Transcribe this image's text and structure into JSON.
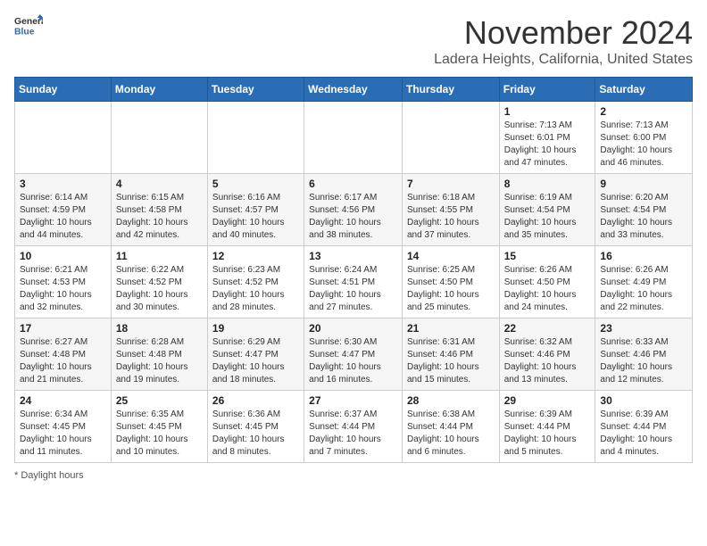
{
  "header": {
    "logo_line1": "General",
    "logo_line2": "Blue",
    "month_title": "November 2024",
    "location": "Ladera Heights, California, United States"
  },
  "weekdays": [
    "Sunday",
    "Monday",
    "Tuesday",
    "Wednesday",
    "Thursday",
    "Friday",
    "Saturday"
  ],
  "weeks": [
    [
      {
        "day": "",
        "info": ""
      },
      {
        "day": "",
        "info": ""
      },
      {
        "day": "",
        "info": ""
      },
      {
        "day": "",
        "info": ""
      },
      {
        "day": "",
        "info": ""
      },
      {
        "day": "1",
        "info": "Sunrise: 7:13 AM\nSunset: 6:01 PM\nDaylight: 10 hours and 47 minutes."
      },
      {
        "day": "2",
        "info": "Sunrise: 7:13 AM\nSunset: 6:00 PM\nDaylight: 10 hours and 46 minutes."
      }
    ],
    [
      {
        "day": "3",
        "info": "Sunrise: 6:14 AM\nSunset: 4:59 PM\nDaylight: 10 hours and 44 minutes."
      },
      {
        "day": "4",
        "info": "Sunrise: 6:15 AM\nSunset: 4:58 PM\nDaylight: 10 hours and 42 minutes."
      },
      {
        "day": "5",
        "info": "Sunrise: 6:16 AM\nSunset: 4:57 PM\nDaylight: 10 hours and 40 minutes."
      },
      {
        "day": "6",
        "info": "Sunrise: 6:17 AM\nSunset: 4:56 PM\nDaylight: 10 hours and 38 minutes."
      },
      {
        "day": "7",
        "info": "Sunrise: 6:18 AM\nSunset: 4:55 PM\nDaylight: 10 hours and 37 minutes."
      },
      {
        "day": "8",
        "info": "Sunrise: 6:19 AM\nSunset: 4:54 PM\nDaylight: 10 hours and 35 minutes."
      },
      {
        "day": "9",
        "info": "Sunrise: 6:20 AM\nSunset: 4:54 PM\nDaylight: 10 hours and 33 minutes."
      }
    ],
    [
      {
        "day": "10",
        "info": "Sunrise: 6:21 AM\nSunset: 4:53 PM\nDaylight: 10 hours and 32 minutes."
      },
      {
        "day": "11",
        "info": "Sunrise: 6:22 AM\nSunset: 4:52 PM\nDaylight: 10 hours and 30 minutes."
      },
      {
        "day": "12",
        "info": "Sunrise: 6:23 AM\nSunset: 4:52 PM\nDaylight: 10 hours and 28 minutes."
      },
      {
        "day": "13",
        "info": "Sunrise: 6:24 AM\nSunset: 4:51 PM\nDaylight: 10 hours and 27 minutes."
      },
      {
        "day": "14",
        "info": "Sunrise: 6:25 AM\nSunset: 4:50 PM\nDaylight: 10 hours and 25 minutes."
      },
      {
        "day": "15",
        "info": "Sunrise: 6:26 AM\nSunset: 4:50 PM\nDaylight: 10 hours and 24 minutes."
      },
      {
        "day": "16",
        "info": "Sunrise: 6:26 AM\nSunset: 4:49 PM\nDaylight: 10 hours and 22 minutes."
      }
    ],
    [
      {
        "day": "17",
        "info": "Sunrise: 6:27 AM\nSunset: 4:48 PM\nDaylight: 10 hours and 21 minutes."
      },
      {
        "day": "18",
        "info": "Sunrise: 6:28 AM\nSunset: 4:48 PM\nDaylight: 10 hours and 19 minutes."
      },
      {
        "day": "19",
        "info": "Sunrise: 6:29 AM\nSunset: 4:47 PM\nDaylight: 10 hours and 18 minutes."
      },
      {
        "day": "20",
        "info": "Sunrise: 6:30 AM\nSunset: 4:47 PM\nDaylight: 10 hours and 16 minutes."
      },
      {
        "day": "21",
        "info": "Sunrise: 6:31 AM\nSunset: 4:46 PM\nDaylight: 10 hours and 15 minutes."
      },
      {
        "day": "22",
        "info": "Sunrise: 6:32 AM\nSunset: 4:46 PM\nDaylight: 10 hours and 13 minutes."
      },
      {
        "day": "23",
        "info": "Sunrise: 6:33 AM\nSunset: 4:46 PM\nDaylight: 10 hours and 12 minutes."
      }
    ],
    [
      {
        "day": "24",
        "info": "Sunrise: 6:34 AM\nSunset: 4:45 PM\nDaylight: 10 hours and 11 minutes."
      },
      {
        "day": "25",
        "info": "Sunrise: 6:35 AM\nSunset: 4:45 PM\nDaylight: 10 hours and 10 minutes."
      },
      {
        "day": "26",
        "info": "Sunrise: 6:36 AM\nSunset: 4:45 PM\nDaylight: 10 hours and 8 minutes."
      },
      {
        "day": "27",
        "info": "Sunrise: 6:37 AM\nSunset: 4:44 PM\nDaylight: 10 hours and 7 minutes."
      },
      {
        "day": "28",
        "info": "Sunrise: 6:38 AM\nSunset: 4:44 PM\nDaylight: 10 hours and 6 minutes."
      },
      {
        "day": "29",
        "info": "Sunrise: 6:39 AM\nSunset: 4:44 PM\nDaylight: 10 hours and 5 minutes."
      },
      {
        "day": "30",
        "info": "Sunrise: 6:39 AM\nSunset: 4:44 PM\nDaylight: 10 hours and 4 minutes."
      }
    ]
  ],
  "footer": {
    "note": "Daylight hours"
  }
}
